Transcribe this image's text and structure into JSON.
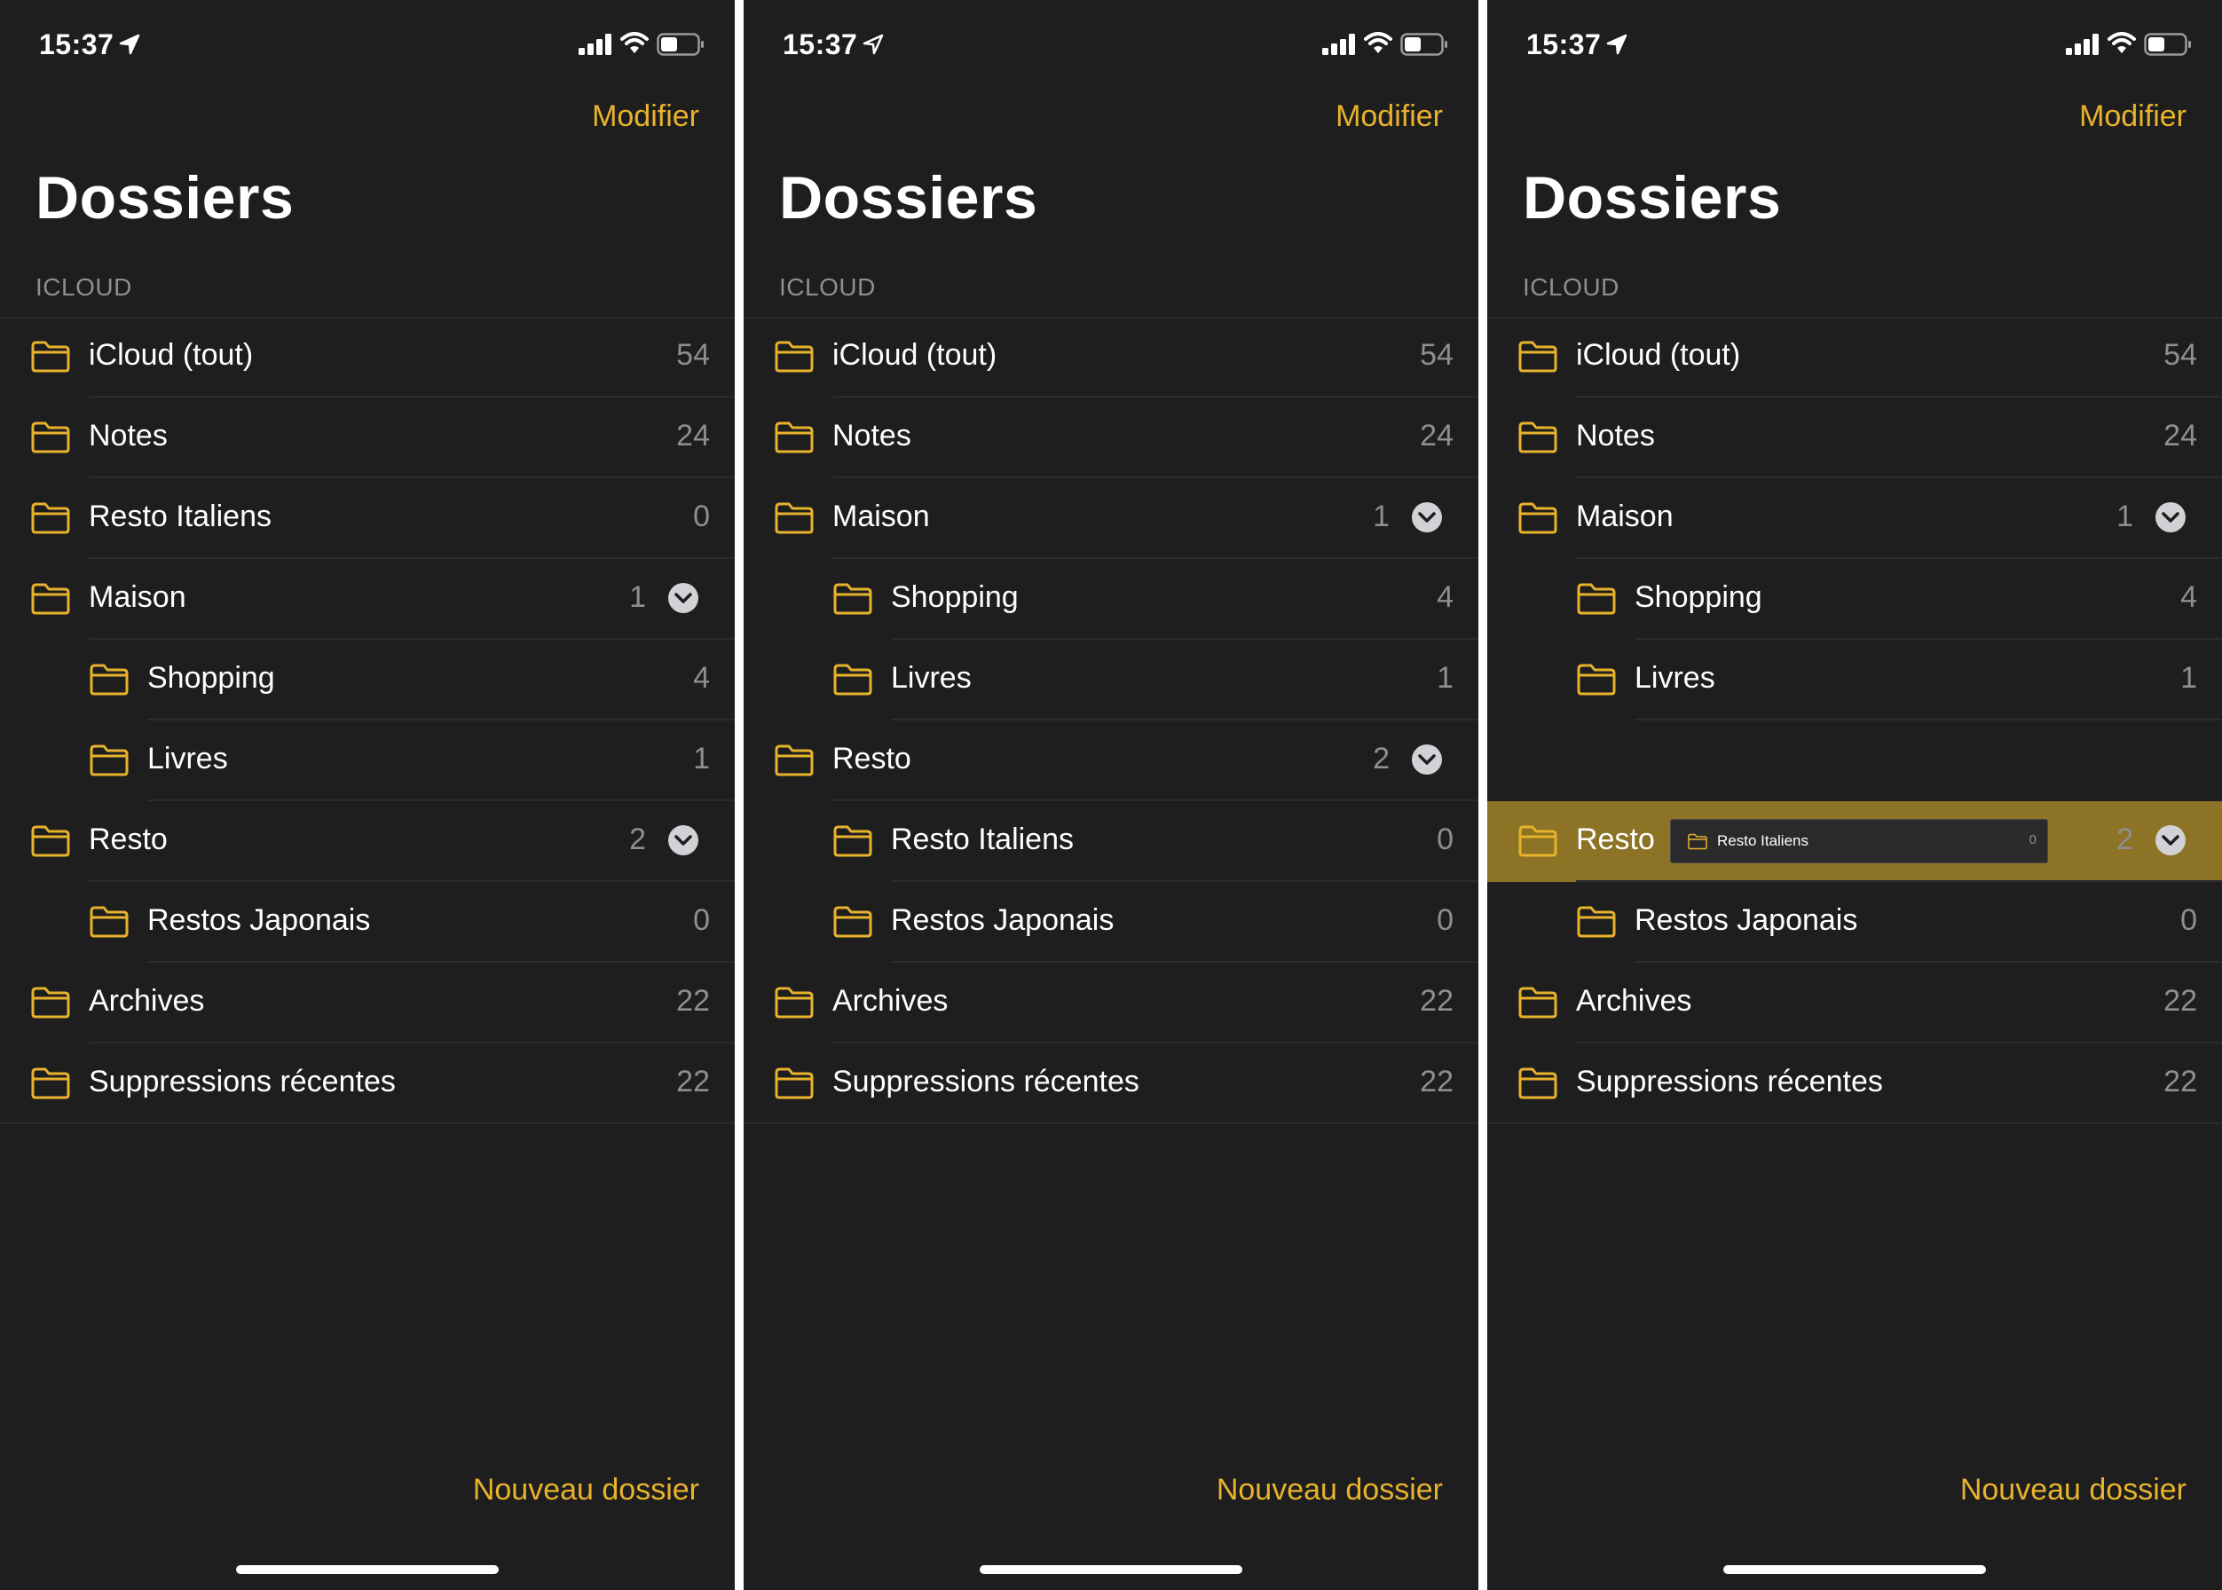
{
  "colors": {
    "accent": "#e8b32c",
    "background": "#1e1e1f",
    "separator": "#2c2c2e",
    "secondary_text": "#8e8e93",
    "drop_highlight": "#8c7326"
  },
  "screens": [
    {
      "status": {
        "time": "15:37"
      },
      "nav": {
        "edit_label": "Modifier"
      },
      "title": "Dossiers",
      "section": "ICLOUD",
      "rows": [
        {
          "label": "iCloud (tout)",
          "count": "54",
          "level": 0,
          "chevron": false
        },
        {
          "label": "Notes",
          "count": "24",
          "level": 0,
          "chevron": false
        },
        {
          "label": "Resto Italiens",
          "count": "0",
          "level": 0,
          "chevron": false
        },
        {
          "label": "Maison",
          "count": "1",
          "level": 0,
          "chevron": true
        },
        {
          "label": "Shopping",
          "count": "4",
          "level": 1,
          "chevron": false
        },
        {
          "label": "Livres",
          "count": "1",
          "level": 1,
          "chevron": false
        },
        {
          "label": "Resto",
          "count": "2",
          "level": 0,
          "chevron": true
        },
        {
          "label": "Restos Japonais",
          "count": "0",
          "level": 1,
          "chevron": false
        },
        {
          "label": "Archives",
          "count": "22",
          "level": 0,
          "chevron": false
        },
        {
          "label": "Suppressions récentes",
          "count": "22",
          "level": 0,
          "chevron": false
        }
      ],
      "footer": {
        "new_folder_label": "Nouveau dossier"
      }
    },
    {
      "status": {
        "time": "15:37"
      },
      "nav": {
        "edit_label": "Modifier"
      },
      "title": "Dossiers",
      "section": "ICLOUD",
      "rows": [
        {
          "label": "iCloud (tout)",
          "count": "54",
          "level": 0,
          "chevron": false
        },
        {
          "label": "Notes",
          "count": "24",
          "level": 0,
          "chevron": false
        },
        {
          "label": "Maison",
          "count": "1",
          "level": 0,
          "chevron": true
        },
        {
          "label": "Shopping",
          "count": "4",
          "level": 1,
          "chevron": false
        },
        {
          "label": "Livres",
          "count": "1",
          "level": 1,
          "chevron": false
        },
        {
          "label": "Resto",
          "count": "2",
          "level": 0,
          "chevron": true
        },
        {
          "label": "Resto Italiens",
          "count": "0",
          "level": 1,
          "chevron": false
        },
        {
          "label": "Restos Japonais",
          "count": "0",
          "level": 1,
          "chevron": false
        },
        {
          "label": "Archives",
          "count": "22",
          "level": 0,
          "chevron": false
        },
        {
          "label": "Suppressions récentes",
          "count": "22",
          "level": 0,
          "chevron": false
        }
      ],
      "footer": {
        "new_folder_label": "Nouveau dossier"
      }
    },
    {
      "status": {
        "time": "15:37"
      },
      "nav": {
        "edit_label": "Modifier"
      },
      "title": "Dossiers",
      "section": "ICLOUD",
      "rows": [
        {
          "label": "iCloud (tout)",
          "count": "54",
          "level": 0,
          "chevron": false
        },
        {
          "label": "Notes",
          "count": "24",
          "level": 0,
          "chevron": false
        },
        {
          "label": "Maison",
          "count": "1",
          "level": 0,
          "chevron": true
        },
        {
          "label": "Shopping",
          "count": "4",
          "level": 1,
          "chevron": false
        },
        {
          "label": "Livres",
          "count": "1",
          "level": 1,
          "chevron": false
        },
        {
          "spacer": true
        },
        {
          "label": "Resto",
          "count": "2",
          "level": 0,
          "chevron": true,
          "highlight": true,
          "drag": {
            "label": "Resto Italiens",
            "count": "0"
          }
        },
        {
          "label": "Restos Japonais",
          "count": "0",
          "level": 1,
          "chevron": false
        },
        {
          "label": "Archives",
          "count": "22",
          "level": 0,
          "chevron": false
        },
        {
          "label": "Suppressions récentes",
          "count": "22",
          "level": 0,
          "chevron": false
        }
      ],
      "footer": {
        "new_folder_label": "Nouveau dossier"
      }
    }
  ]
}
